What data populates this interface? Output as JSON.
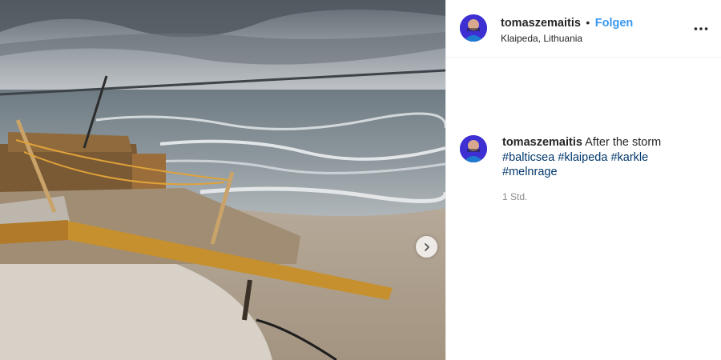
{
  "post": {
    "author": "tomaszemaitis",
    "separator": "•",
    "follow_label": "Folgen",
    "location": "Klaipeda, Lithuania"
  },
  "caption": {
    "author": "tomaszemaitis",
    "text": "After the storm",
    "hashtags": [
      "#balticsea",
      "#klaipeda",
      "#karkle",
      "#melnrage"
    ],
    "time_ago": "1 Std."
  },
  "icons": {
    "more": "more-options-icon",
    "next": "chevron-right-icon"
  },
  "colors": {
    "link_blue": "#3897f0",
    "hashtag": "#00376b",
    "muted": "#8e8e8e"
  }
}
